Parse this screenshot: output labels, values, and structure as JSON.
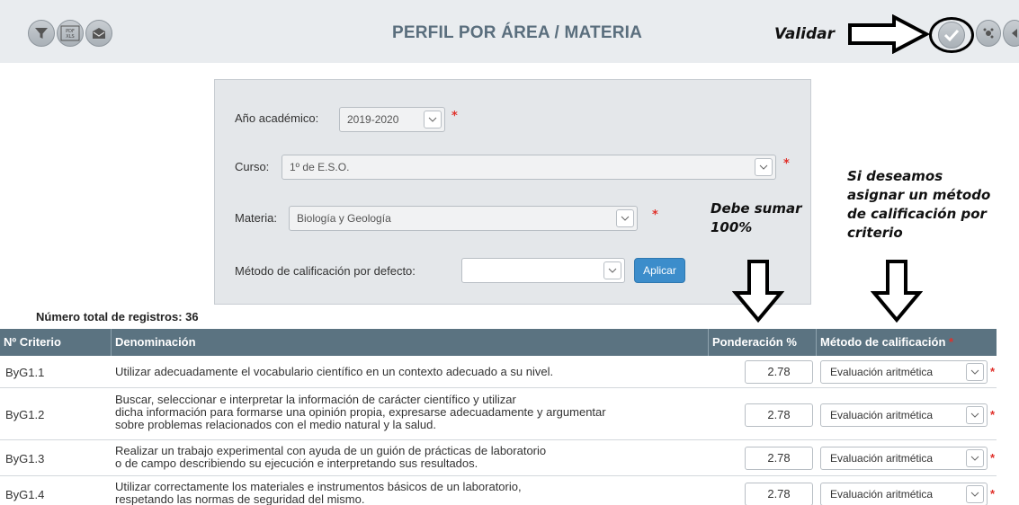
{
  "header": {
    "title": "PERFIL POR ÁREA / MATERIA",
    "icons": [
      "filter-icon",
      "pdf-xls-export-icon",
      "mail-icon",
      "validate-check-icon",
      "settings-icon",
      "back-icon"
    ]
  },
  "annotations": {
    "validar": "Validar",
    "debe_sumar_line1": "Debe sumar",
    "debe_sumar_line2": "100%",
    "metodo_line1": "Si deseamos",
    "metodo_line2": "asignar un método",
    "metodo_line3": "de calificación por",
    "metodo_line4": "criterio"
  },
  "filters": {
    "anio_label": "Año académico:",
    "anio_value": "2019-2020",
    "curso_label": "Curso:",
    "curso_value": "1º de E.S.O.",
    "materia_label": "Materia:",
    "materia_value": "Biología y Geología",
    "metodo_label": "Método de calificación por defecto:",
    "metodo_value": "",
    "apply_label": "Aplicar",
    "required_mark": "*"
  },
  "summary": {
    "total_label": "Número total de registros: 36"
  },
  "table": {
    "headers": {
      "criterio": "Nº Criterio",
      "denominacion": "Denominación",
      "ponderacion": "Ponderación %",
      "metodo": "Método de calificación"
    },
    "rows": [
      {
        "id": "ByG1.1",
        "denom1": "Utilizar adecuadamente el vocabulario científico en un contexto adecuado a su nivel.",
        "denom2": "",
        "denom3": "",
        "ponderacion": "2.78",
        "metodo": "Evaluación aritmética"
      },
      {
        "id": "ByG1.2",
        "denom1": "Buscar, seleccionar e interpretar la información de carácter científico y utilizar",
        "denom2": "dicha información para formarse una opinión propia, expresarse adecuadamente y argumentar",
        "denom3": "sobre problemas relacionados con el medio natural y la salud.",
        "ponderacion": "2.78",
        "metodo": "Evaluación aritmética"
      },
      {
        "id": "ByG1.3",
        "denom1": "Realizar un trabajo experimental con ayuda de un guión de prácticas de laboratorio",
        "denom2": "o de campo describiendo su ejecución e interpretando sus resultados.",
        "denom3": "",
        "ponderacion": "2.78",
        "metodo": "Evaluación aritmética"
      },
      {
        "id": "ByG1.4",
        "denom1": "Utilizar correctamente los materiales e instrumentos básicos de un laboratorio,",
        "denom2": "respetando las normas de seguridad del mismo.",
        "denom3": "",
        "ponderacion": "2.78",
        "metodo": "Evaluación aritmética"
      }
    ]
  },
  "colors": {
    "header_bg": "#e9ecef",
    "title": "#5a6e7d",
    "table_header": "#5b7381",
    "apply_button": "#3c8dcb",
    "required": "#e0302a"
  }
}
